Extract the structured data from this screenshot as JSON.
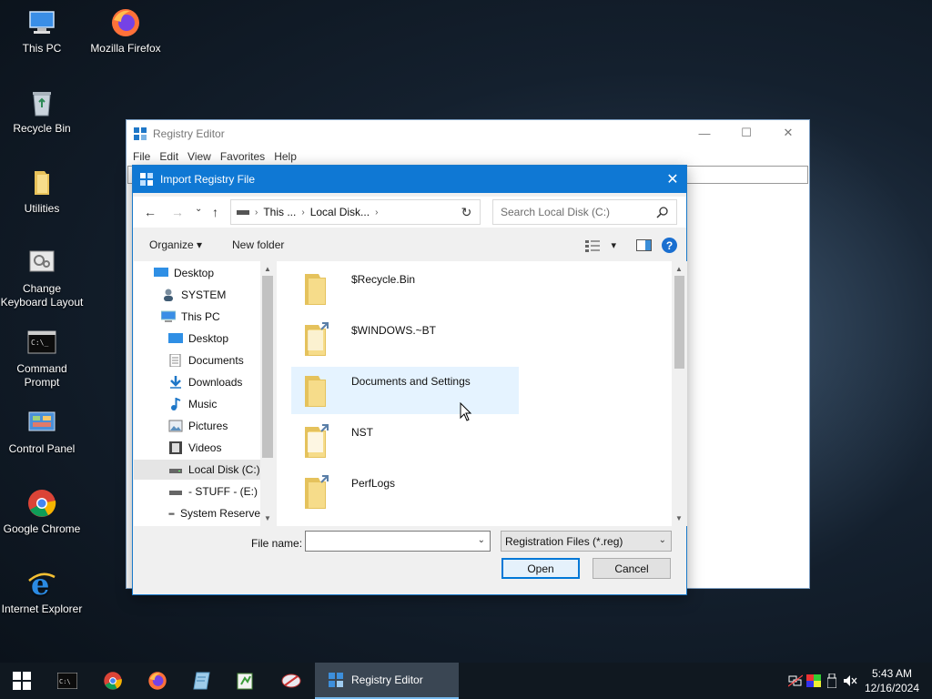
{
  "desktop": {
    "icons": [
      {
        "label": "This PC"
      },
      {
        "label": "Mozilla Firefox"
      },
      {
        "label": "Recycle Bin"
      },
      {
        "label": "Utilities"
      },
      {
        "label": "Change Keyboard Layout"
      },
      {
        "label": "Command Prompt"
      },
      {
        "label": "Control Panel"
      },
      {
        "label": "Google Chrome"
      },
      {
        "label": "Internet Explorer"
      }
    ]
  },
  "regedit": {
    "title": "Registry Editor",
    "menu": [
      "File",
      "Edit",
      "View",
      "Favorites",
      "Help"
    ],
    "controls": {
      "minimize": "—",
      "maximize": "☐",
      "close": "✕"
    }
  },
  "dialog": {
    "title": "Import Registry File",
    "close": "✕",
    "nav": {
      "back": "←",
      "forward": "→",
      "recent": "⌄",
      "up": "↑",
      "refresh": "↻"
    },
    "address": {
      "segments": [
        "This ...",
        "Local Disk..."
      ],
      "sep": "›",
      "dropdown": "⌄"
    },
    "search": {
      "placeholder": "Search Local Disk (C:)"
    },
    "commands": {
      "organize": "Organize ▾",
      "new_folder": "New folder",
      "view_dd": "▾",
      "help": "?"
    },
    "tree": [
      {
        "label": "Desktop",
        "icon": "desktop-icon",
        "level": 0
      },
      {
        "label": "SYSTEM",
        "icon": "user-icon",
        "level": 1
      },
      {
        "label": "This PC",
        "icon": "pc-icon",
        "level": 1
      },
      {
        "label": "Desktop",
        "icon": "desktop-icon",
        "level": 2
      },
      {
        "label": "Documents",
        "icon": "documents-icon",
        "level": 2
      },
      {
        "label": "Downloads",
        "icon": "downloads-icon",
        "level": 2
      },
      {
        "label": "Music",
        "icon": "music-icon",
        "level": 2
      },
      {
        "label": "Pictures",
        "icon": "pictures-icon",
        "level": 2
      },
      {
        "label": "Videos",
        "icon": "videos-icon",
        "level": 2
      },
      {
        "label": "Local Disk (C:)",
        "icon": "drive-icon",
        "level": 2,
        "selected": true
      },
      {
        "label": "- STUFF - (E:)",
        "icon": "drive-icon",
        "level": 2
      },
      {
        "label": "System Reserve",
        "icon": "drive-icon",
        "level": 2
      }
    ],
    "files": [
      {
        "name": "$Recycle.Bin",
        "icon": "folder-icon"
      },
      {
        "name": "$WINDOWS.~BT",
        "icon": "folder-shortcut-icon"
      },
      {
        "name": "Documents and Settings",
        "icon": "folder-icon",
        "hover": true
      },
      {
        "name": "NST",
        "icon": "folder-shortcut-icon"
      },
      {
        "name": "PerfLogs",
        "icon": "folder-shortcut-icon"
      }
    ],
    "filename": {
      "label": "File name:",
      "value": ""
    },
    "filetype": {
      "selected": "Registration Files (*.reg)"
    },
    "buttons": {
      "open": "Open",
      "cancel": "Cancel"
    }
  },
  "taskbar": {
    "pinned": [
      "start-icon",
      "cmd-icon",
      "chrome-icon",
      "firefox-icon",
      "notepad-icon",
      "editor-icon",
      "snipping-icon"
    ],
    "active_app": {
      "label": "Registry Editor"
    },
    "clock": {
      "time": "5:43 AM",
      "date": "12/16/2024"
    }
  }
}
